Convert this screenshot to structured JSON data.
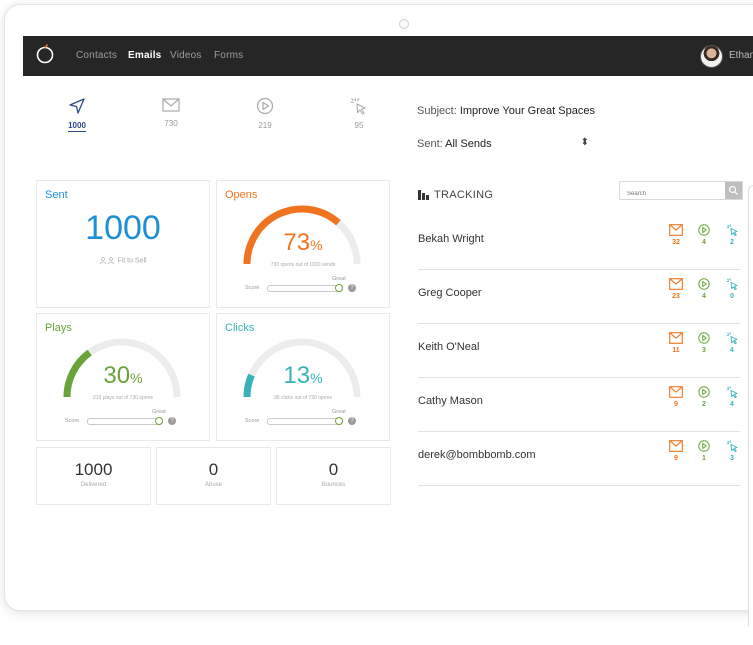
{
  "nav": {
    "links": [
      "Contacts",
      "Emails",
      "Videos",
      "Forms"
    ],
    "active": "Emails",
    "user_name": "Ethan"
  },
  "stats": {
    "sent": "1000",
    "opens": "730",
    "plays": "219",
    "clicks": "95"
  },
  "subject": {
    "label": "Subject:",
    "value": "Improve Your Great Spaces"
  },
  "sent_filter": {
    "label": "Sent:",
    "value": "All Sends"
  },
  "cards": {
    "sent": {
      "title": "Sent",
      "value": "1000",
      "subtitle": "Fit to Sell"
    },
    "opens": {
      "title": "Opens",
      "value": "73",
      "unit": "%",
      "caption": "730 opens out of 1000 sends",
      "score_label": "Score",
      "great_label": "Great",
      "fraction": 0.73
    },
    "plays": {
      "title": "Plays",
      "value": "30",
      "unit": "%",
      "caption": "219 plays out of 730 opens",
      "score_label": "Score",
      "great_label": "Great",
      "fraction": 0.3
    },
    "clicks": {
      "title": "Clicks",
      "value": "13",
      "unit": "%",
      "caption": "95 clicks out of 730 opens",
      "score_label": "Score",
      "great_label": "Great",
      "fraction": 0.13
    }
  },
  "mini_stats": [
    {
      "value": "1000",
      "label": "Delivered"
    },
    {
      "value": "0",
      "label": "Abuse"
    },
    {
      "value": "0",
      "label": "Bounces"
    }
  ],
  "tracking": {
    "title": "TRACKING",
    "search_placeholder": "Search",
    "rows": [
      {
        "name": "Bekah Wright",
        "opens": "32",
        "plays": "4",
        "clicks": "2"
      },
      {
        "name": "Greg Cooper",
        "opens": "23",
        "plays": "4",
        "clicks": "0"
      },
      {
        "name": "Keith O'Neal",
        "opens": "11",
        "plays": "3",
        "clicks": "4"
      },
      {
        "name": "Cathy Mason",
        "opens": "9",
        "plays": "2",
        "clicks": "4"
      },
      {
        "name": "derek@bombbomb.com",
        "opens": "9",
        "plays": "1",
        "clicks": "3"
      }
    ]
  },
  "colors": {
    "sent": "#1e8fd6",
    "opens": "#f0731f",
    "plays": "#6aa33a",
    "clicks": "#37b3b8",
    "nav_bg": "#262626"
  }
}
